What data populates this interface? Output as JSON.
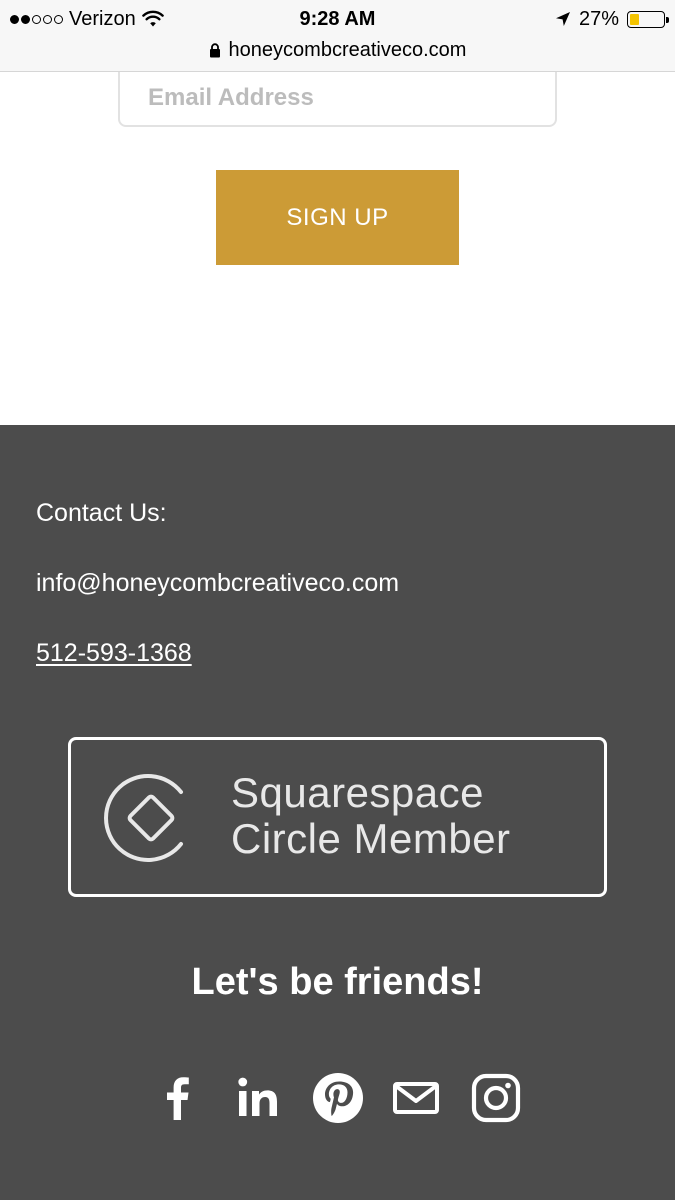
{
  "status_bar": {
    "carrier": "Verizon",
    "time": "9:28 AM",
    "battery_percent": "27%",
    "battery_level": 0.27,
    "signal_bars_filled": 2,
    "signal_bars_total": 5
  },
  "url_bar": {
    "domain": "honeycombcreativeco.com"
  },
  "newsletter": {
    "email_placeholder": "Email Address",
    "signup_label": "SIGN UP"
  },
  "footer": {
    "contact_heading": "Contact Us:",
    "email": "info@honeycombcreativeco.com",
    "phone": "512-593-1368",
    "badge_line1": "Squarespace",
    "badge_line2": "Circle Member",
    "friends_heading": "Let's be friends!",
    "social": [
      {
        "icon": "facebook-icon"
      },
      {
        "icon": "linkedin-icon"
      },
      {
        "icon": "pinterest-icon"
      },
      {
        "icon": "mail-icon"
      },
      {
        "icon": "instagram-icon"
      }
    ]
  },
  "colors": {
    "accent": "#cc9b36",
    "footer_bg": "#4c4c4c",
    "battery": "#f4c400"
  }
}
